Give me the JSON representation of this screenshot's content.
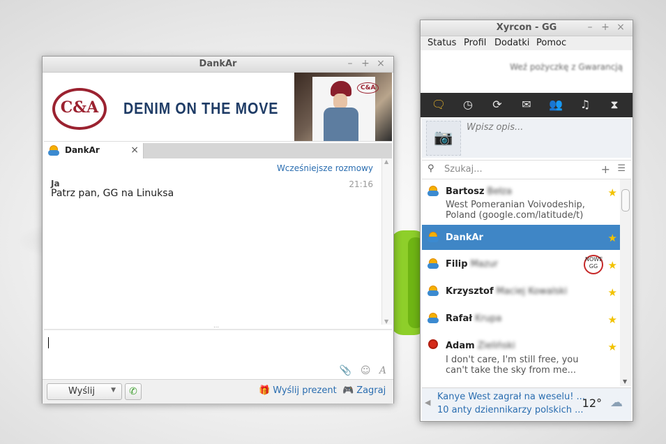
{
  "chat_window": {
    "title": "DankAr",
    "controls": {
      "minimize": "–",
      "maximize": "+",
      "close": "×"
    },
    "ad": {
      "logo": "C&A",
      "text": "DENIM ON THE MOVE",
      "mini_logo": "C&A"
    },
    "tab": {
      "label": "DankAr",
      "close": "×"
    },
    "conversation": {
      "earlier_link": "Wcześniejsze rozmowy",
      "sender": "Ja",
      "time": "21:16",
      "message": "Patrz pan, GG na Linuksa"
    },
    "input_icons": {
      "attach": "📎",
      "emoji": "☺",
      "font": "A"
    },
    "bottom": {
      "send_label": "Wyślij",
      "gift_label": "Wyślij prezent",
      "play_label": "Zagraj"
    }
  },
  "main_window": {
    "title": "Xyrcon - GG",
    "controls": {
      "minimize": "–",
      "maximize": "+",
      "close": "×"
    },
    "menu": [
      "Status",
      "Profil",
      "Dodatki",
      "Pomoc"
    ],
    "promo_text": "Weź pożyczkę z Gwarancją",
    "toolbar_icons": [
      "chat-icon",
      "history-icon",
      "refresh-icon",
      "mail-icon",
      "contacts-icon",
      "music-icon",
      "game-icon"
    ],
    "description_placeholder": "Wpisz opis...",
    "search_placeholder": "Szukaj...",
    "contacts": [
      {
        "first": "Bartosz",
        "last": "Bełza",
        "status": "West Pomeranian Voivodeship, Poland (google.com/latitude/t)"
      },
      {
        "first": "DankAr",
        "last": "",
        "status": ""
      },
      {
        "first": "Filip",
        "last": "Mazur",
        "status": "",
        "badge": "NOWE GG"
      },
      {
        "first": "Krzysztof",
        "last": "Maciej Kowalski",
        "status": ""
      },
      {
        "first": "Rafał",
        "last": "Krupa",
        "status": ""
      },
      {
        "first": "Adam",
        "last": "Zieliński",
        "status": "I don't care, I'm still free, you can't take the sky from me..."
      }
    ],
    "news": {
      "item1": "Kanye West zagrał na weselu! ...",
      "item2": "10 anty dziennikarzy polskich ...",
      "temperature": "12°"
    }
  }
}
